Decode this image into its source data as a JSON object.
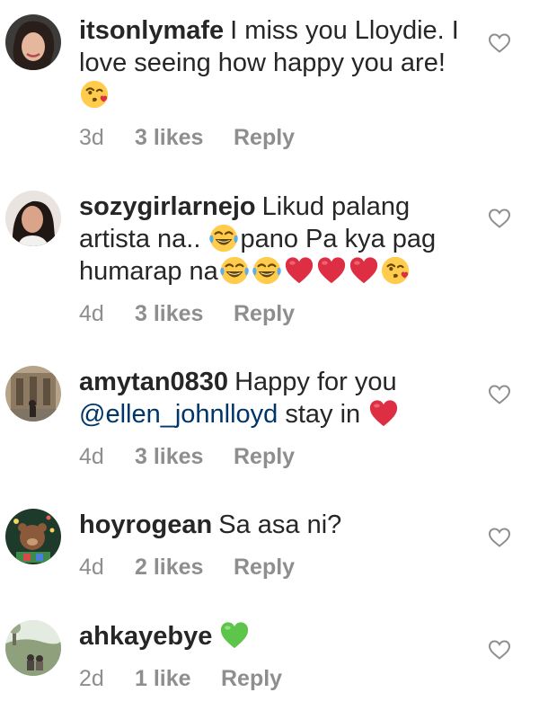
{
  "comments": [
    {
      "username": "itsonlymafe",
      "text": "I miss you Lloydie. I love seeing how happy you are!",
      "emojis": [
        "kissing-face-heart-emoji"
      ],
      "age": "3d",
      "likes": "3 likes",
      "reply": "Reply",
      "avatar": "avatar-itsonlymafe",
      "like_icon": "heart-outline-icon"
    },
    {
      "username": "sozygirlarnejo",
      "text_1": "Likud palang artista na..",
      "text_2": "pano Pa kya pag humarap na",
      "emojis": [
        "tears-of-joy-emoji",
        "tears-of-joy-emoji",
        "tears-of-joy-emoji",
        "red-heart-emoji",
        "red-heart-emoji",
        "red-heart-emoji",
        "kissing-face-heart-emoji"
      ],
      "age": "4d",
      "likes": "3 likes",
      "reply": "Reply",
      "avatar": "avatar-sozygirlarnejo",
      "like_icon": "heart-outline-icon"
    },
    {
      "username": "amytan0830",
      "text_1": "Happy for you",
      "mention": "@ellen_johnlloyd",
      "text_2": "stay in",
      "emojis": [
        "red-heart-emoji"
      ],
      "age": "4d",
      "likes": "3 likes",
      "reply": "Reply",
      "avatar": "avatar-amytan0830",
      "like_icon": "heart-outline-icon"
    },
    {
      "username": "hoyrogean",
      "text": "Sa asa ni?",
      "age": "4d",
      "likes": "2 likes",
      "reply": "Reply",
      "avatar": "avatar-hoyrogean",
      "like_icon": "heart-outline-icon"
    },
    {
      "username": "ahkayebye",
      "text": "",
      "emojis": [
        "green-heart-emoji"
      ],
      "age": "2d",
      "likes": "1 like",
      "reply": "Reply",
      "avatar": "avatar-ahkayebye",
      "like_icon": "heart-outline-icon"
    }
  ],
  "colors": {
    "text": "#262626",
    "meta": "#8e8e8e",
    "mention": "#003569",
    "heart_outline": "#8e8e8e",
    "red_heart": "#dd2e44",
    "green_heart": "#5dc54a",
    "emoji_face": "#ffcc4d"
  }
}
